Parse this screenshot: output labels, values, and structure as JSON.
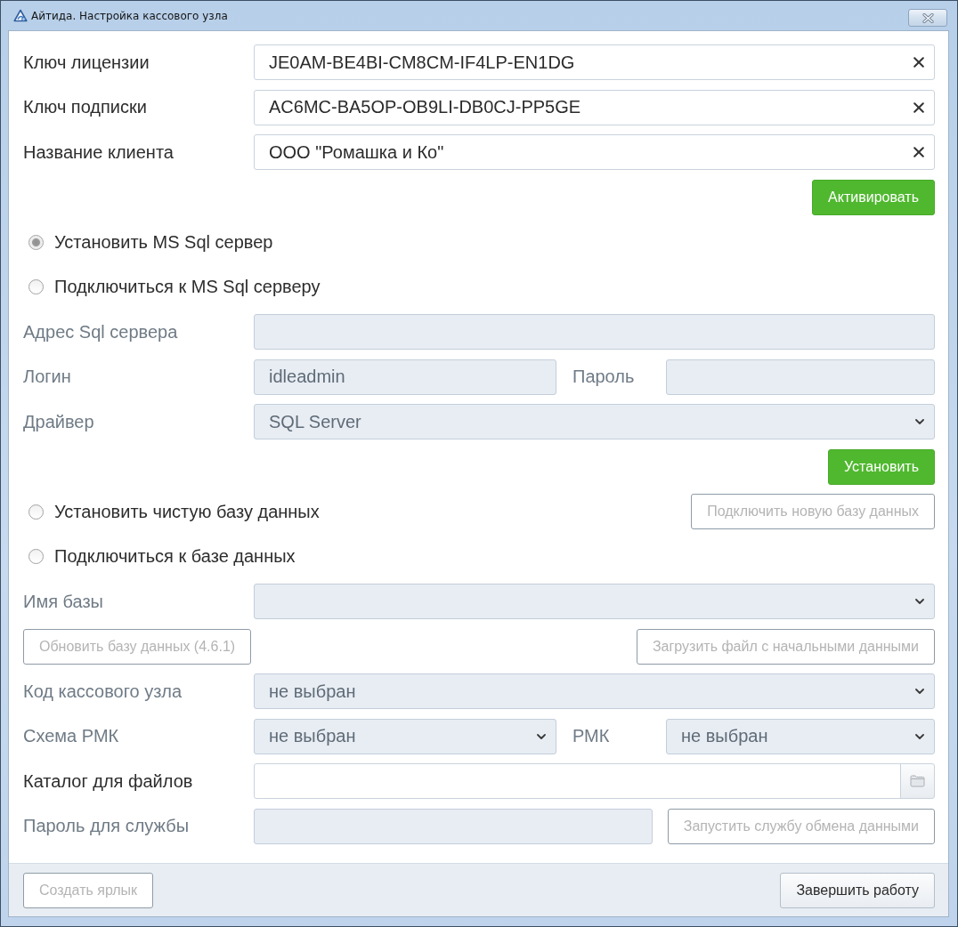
{
  "window": {
    "title": "Айтида. Настройка кассового узла"
  },
  "rows": [
    {
      "kind": "text",
      "label": "Ключ лицензии",
      "value": "JE0AM-BE4BI-CM8CM-IF4LP-EN1DG",
      "disabled": false,
      "clearable": true
    },
    {
      "kind": "text",
      "label": "Ключ подписки",
      "value": "AC6MC-BA5OP-OB9LI-DB0CJ-PP5GE",
      "disabled": false,
      "clearable": true
    },
    {
      "kind": "text",
      "label": "Название клиента",
      "value": "ООО \"Ромашка и Ко\"",
      "disabled": false,
      "clearable": true
    },
    {
      "kind": "actions",
      "buttons": [
        {
          "label": "Активировать",
          "kind": "primary",
          "disabled": false
        }
      ]
    },
    {
      "kind": "radio",
      "label": "Установить MS Sql сервер",
      "selected": true
    },
    {
      "kind": "radio",
      "label": "Подключиться к MS Sql серверу",
      "selected": false
    },
    {
      "kind": "text",
      "label": "Адрес Sql сервера",
      "disabled": true
    },
    {
      "kind": "pair",
      "fields": [
        {
          "kind": "text",
          "label": "Логин",
          "value": "idleadmin",
          "disabled": true
        },
        {
          "kind": "text",
          "label": "Пароль",
          "disabled": true
        }
      ]
    },
    {
      "kind": "select",
      "label": "Драйвер",
      "value": "SQL Server",
      "disabled": true
    },
    {
      "kind": "actions",
      "buttons": [
        {
          "label": "Установить",
          "kind": "primary",
          "disabled": false
        }
      ]
    },
    {
      "kind": "radio",
      "label": "Установить чистую базу данных",
      "selected": false,
      "button": {
        "label": "Подключить новую базу данных",
        "kind": "outline",
        "disabled": true
      }
    },
    {
      "kind": "radio",
      "label": "Подключиться к базе данных",
      "selected": false
    },
    {
      "kind": "select",
      "label": "Имя базы",
      "disabled": true
    },
    {
      "kind": "actions",
      "buttons": [
        {
          "label": "Обновить базу данных (4.6.1)",
          "kind": "outline",
          "disabled": true
        },
        {
          "label": "Загрузить файл с начальными данными",
          "kind": "outline",
          "disabled": true
        }
      ]
    },
    {
      "kind": "select",
      "label": "Код кассового узла",
      "value": "не выбран",
      "disabled": true
    },
    {
      "kind": "pair",
      "fields": [
        {
          "kind": "select",
          "label": "Схема РМК",
          "value": "не выбран",
          "disabled": true
        },
        {
          "kind": "select",
          "label": "РМК",
          "value": "не выбран",
          "disabled": true
        }
      ]
    },
    {
      "kind": "browse",
      "label": "Каталог для файлов",
      "disabled": false
    },
    {
      "kind": "text",
      "label": "Пароль для службы",
      "disabled": true,
      "button": {
        "label": "Запустить службу обмена данными",
        "kind": "outline",
        "disabled": true
      }
    }
  ],
  "footer": {
    "buttons": [
      {
        "label": "Создать ярлык",
        "kind": "outline",
        "disabled": true
      },
      {
        "label": "Завершить работу",
        "kind": "plain",
        "disabled": false
      }
    ]
  }
}
